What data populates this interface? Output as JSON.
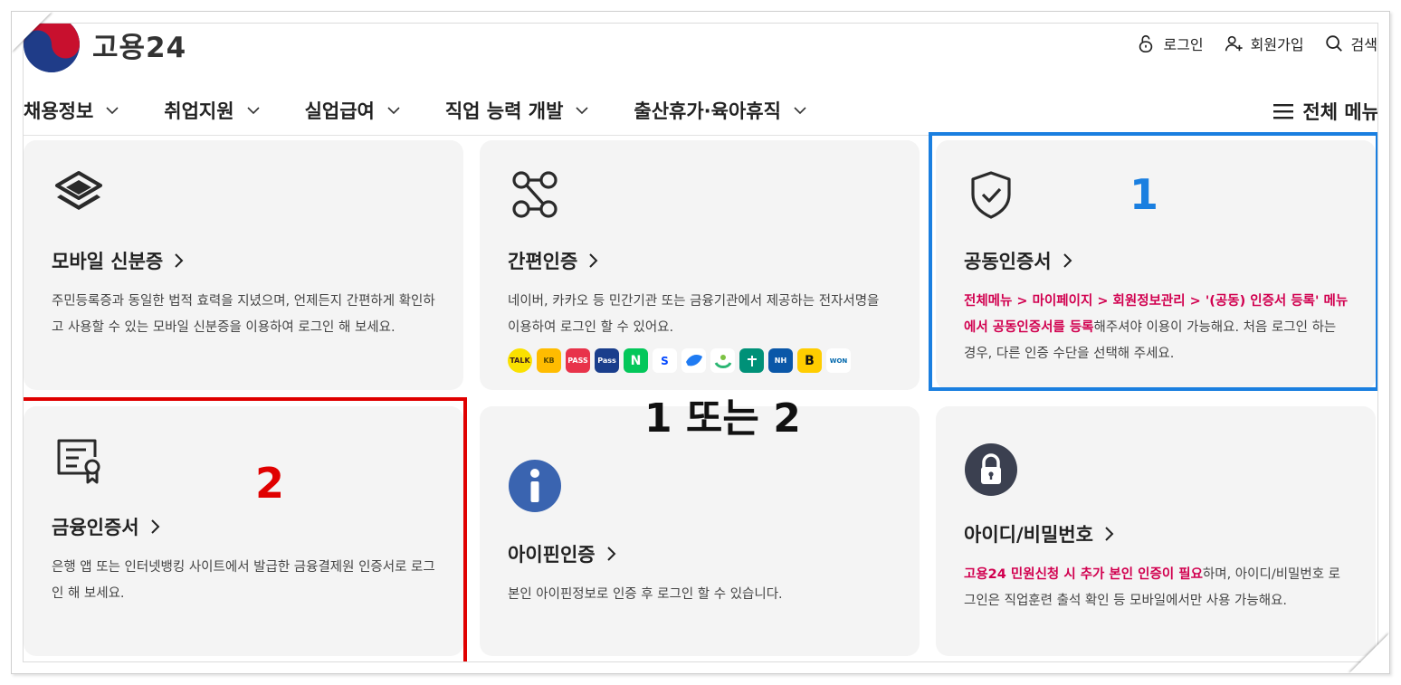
{
  "header": {
    "logo_text": "고용24",
    "utils": [
      {
        "label": "로그인",
        "icon": "unlock-icon"
      },
      {
        "label": "회원가입",
        "icon": "user-plus-icon"
      },
      {
        "label": "검색",
        "icon": "search-icon"
      }
    ]
  },
  "nav": {
    "items": [
      "채용정보",
      "취업지원",
      "실업급여",
      "직업 능력 개발",
      "출산휴가·육아휴직"
    ],
    "all_menu": "전체 메뉴"
  },
  "cards": {
    "mobile_id": {
      "title": "모바일 신분증",
      "desc": "주민등록증과 동일한 법적 효력을 지녔으며, 언제든지 간편하게 확인하고 사용할 수 있는 모바일 신분증을 이용하여 로그인 해 보세요."
    },
    "simple_auth": {
      "title": "간편인증",
      "desc": "네이버, 카카오 등 민간기관 또는 금융기관에서 제공하는 전자서명을 이용하여 로그인 할 수 있어요.",
      "badges": [
        "TALK",
        "KB",
        "PASS",
        "Pass",
        "N",
        "S",
        "",
        "",
        "",
        "NH",
        "B",
        "WON"
      ]
    },
    "joint_cert": {
      "title": "공동인증서",
      "desc_red": "전체메뉴 > 마이페이지 > 회원정보관리 > '(공동) 인증서 등록' 메뉴에서 공동인증서를 등록",
      "desc_rest": "해주셔야 이용이 가능해요. 처음 로그인 하는 경우, 다른 인증 수단을 선택해 주세요."
    },
    "financial_cert": {
      "title": "금융인증서",
      "desc": "은행 앱 또는 인터넷뱅킹 사이트에서 발급한 금융결제원 인증서로 로그인 해 보세요."
    },
    "ipin": {
      "title": "아이핀인증",
      "desc": "본인 아이핀정보로 인증 후 로그인 할 수 있습니다."
    },
    "id_password": {
      "title": "아이디/비밀번호",
      "desc_red": "고용24 민원신청 시 추가 본인 인증이 필요",
      "desc_rest": "하며, 아이디/비밀번호 로그인은 직업훈련 출석 확인 등 모바일에서만 사용 가능해요."
    }
  },
  "annotations": {
    "one": "1",
    "two": "2",
    "one_or_two": "1 또는 2"
  },
  "colors": {
    "annotation_blue": "#1a7fe0",
    "annotation_red": "#e00000",
    "highlight_text": "#d1004f",
    "card_bg": "#f4f4f4"
  }
}
